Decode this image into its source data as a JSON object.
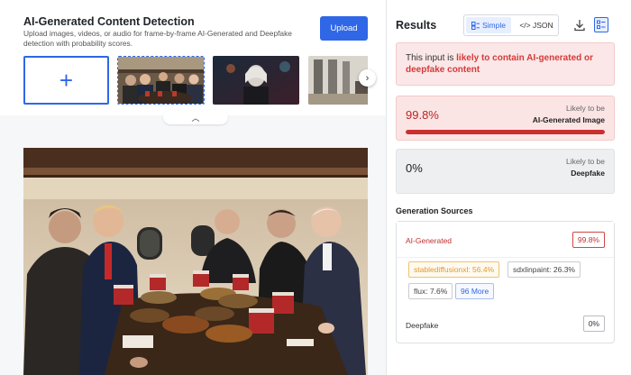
{
  "header": {
    "title": "AI-Generated Content Detection",
    "description": "Upload images, videos, or audio for frame-by-frame AI-Generated and Deepfake detection with probability scores.",
    "upload_label": "Upload"
  },
  "thumbnails": {
    "add_icon": "plus-icon",
    "next_icon": "chevron-right-icon",
    "collapse_icon": "chevron-up-icon"
  },
  "results": {
    "title": "Results",
    "view_toggle": {
      "simple_label": "Simple",
      "json_label": "</> JSON",
      "selected": "Simple"
    },
    "icons": [
      "download-icon",
      "panel-view-icon"
    ],
    "verdict": {
      "prefix": "This input is ",
      "highlight": "likely to contain AI-generated or deepfake content"
    },
    "scores": [
      {
        "value": "99.8%",
        "line1": "Likely to be",
        "line2": "AI-Generated Image",
        "fraction": 0.998
      },
      {
        "value": "0%",
        "line1": "Likely to be",
        "line2": "Deepfake",
        "fraction": 0
      }
    ],
    "generation_sources": {
      "title": "Generation Sources",
      "ai_label": "AI-Generated",
      "ai_value": "99.8%",
      "tags": [
        "stablediffusionxl: 56.4%",
        "sdxlinpaint: 26.3%",
        "flux: 7.6%",
        "96 More"
      ],
      "deepfake_label": "Deepfake",
      "deepfake_value": "0%"
    }
  },
  "colors": {
    "accent": "#2f67e6",
    "alert": "#d63a3a",
    "alert_bg": "#fbe7e7"
  }
}
